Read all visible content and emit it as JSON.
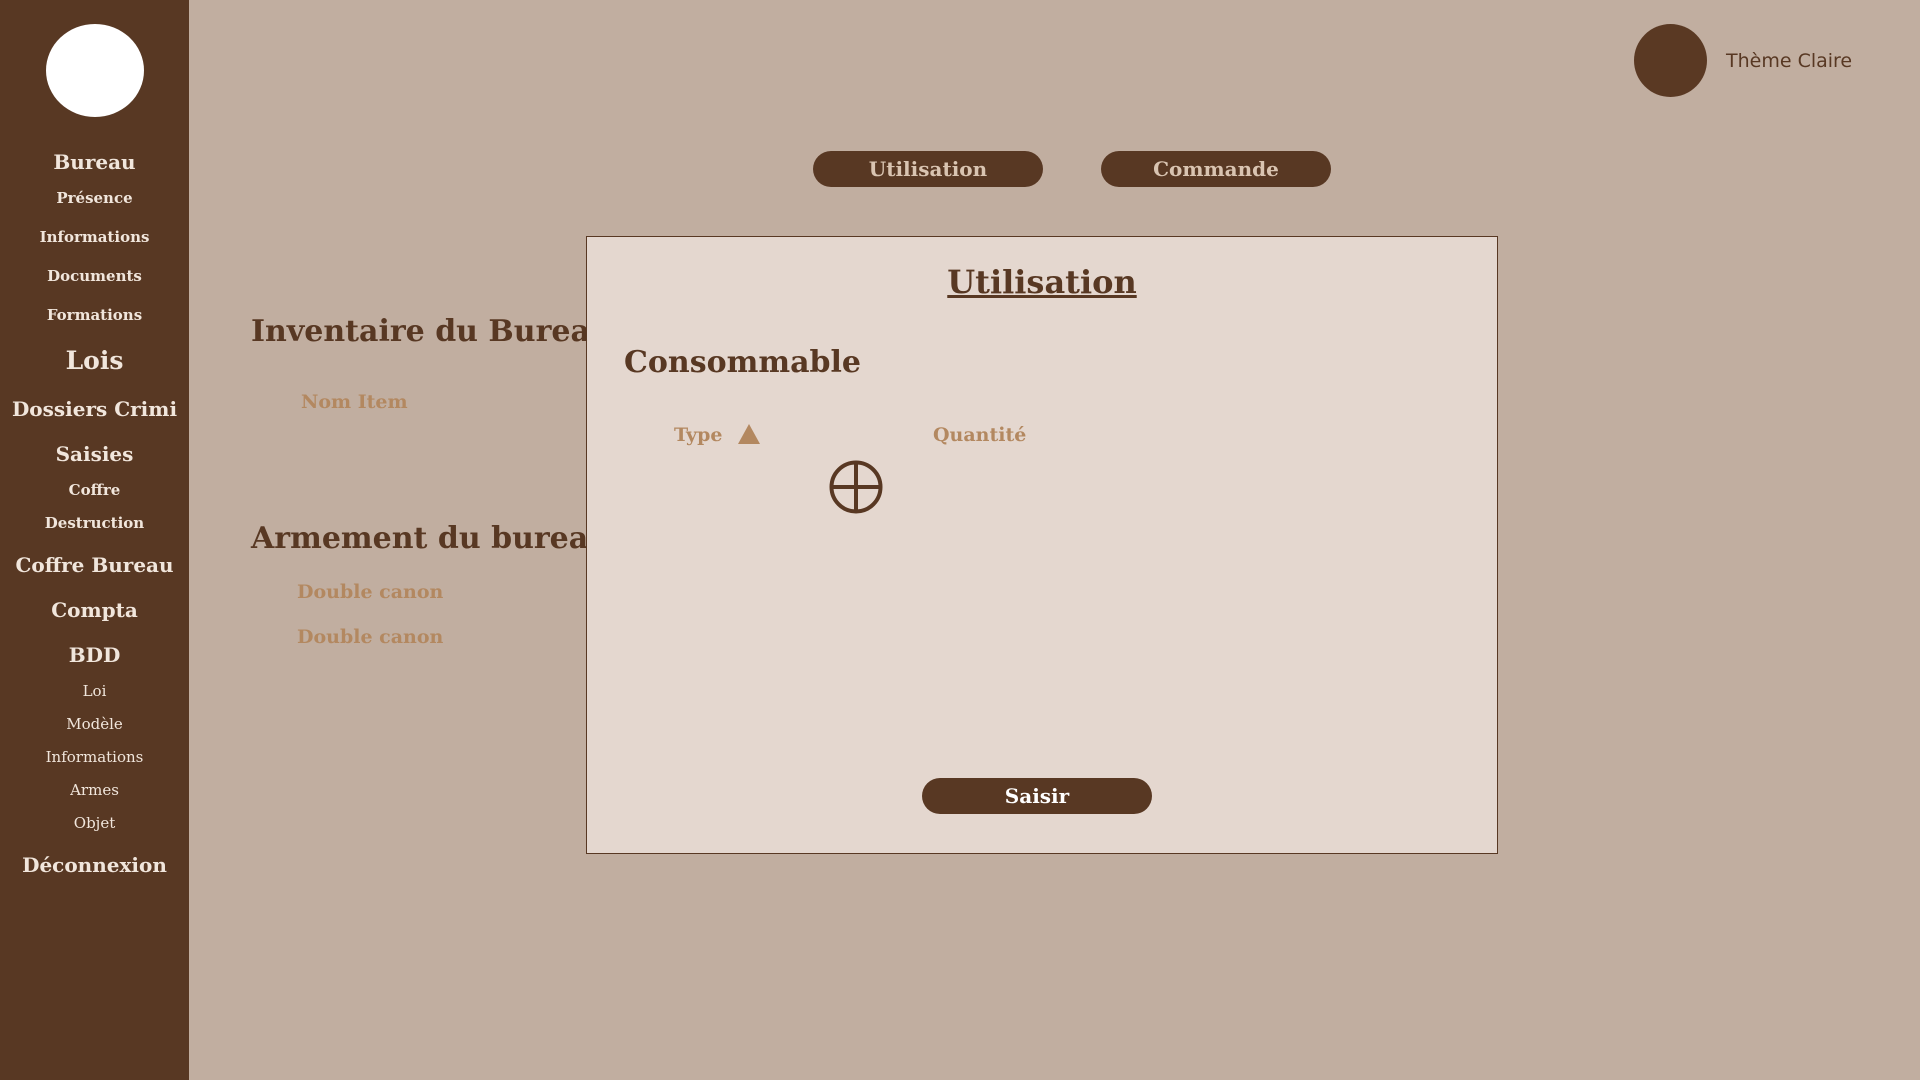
{
  "sidebar": {
    "items": [
      {
        "label": "Bureau"
      },
      {
        "label": "Présence"
      },
      {
        "label": "Informations"
      },
      {
        "label": "Documents"
      },
      {
        "label": "Formations"
      },
      {
        "label": "Lois"
      },
      {
        "label": "Dossiers Crimi"
      },
      {
        "label": "Saisies"
      },
      {
        "label": "Coffre"
      },
      {
        "label": "Destruction"
      },
      {
        "label": "Coffre Bureau"
      },
      {
        "label": "Compta"
      },
      {
        "label": "BDD"
      },
      {
        "label": "Loi"
      },
      {
        "label": "Modèle"
      },
      {
        "label": "Informations"
      },
      {
        "label": "Armes"
      },
      {
        "label": "Objet"
      },
      {
        "label": "Déconnexion"
      }
    ]
  },
  "theme": {
    "label": "Thème Claire"
  },
  "tabs": [
    {
      "label": "Utilisation"
    },
    {
      "label": "Commande"
    }
  ],
  "background": {
    "inventory_title": "Inventaire du Bureau",
    "inventory_column": "Nom Item",
    "armament_title": "Armement du bureau",
    "armament_items": [
      "Double canon",
      "Double canon"
    ]
  },
  "modal": {
    "title": "Utilisation",
    "subtitle": "Consommable",
    "columns": {
      "type": "Type",
      "quantity": "Quantité"
    },
    "submit_label": "Saisir",
    "icons": {
      "sort": "triangle-up-icon",
      "add": "plus-circle-icon"
    }
  },
  "colors": {
    "background": "#c1aea0",
    "sidebar": "#583823",
    "accent_brown": "#583823",
    "muted_tan": "#b38860",
    "modal_bg": "#e4d7cf"
  }
}
